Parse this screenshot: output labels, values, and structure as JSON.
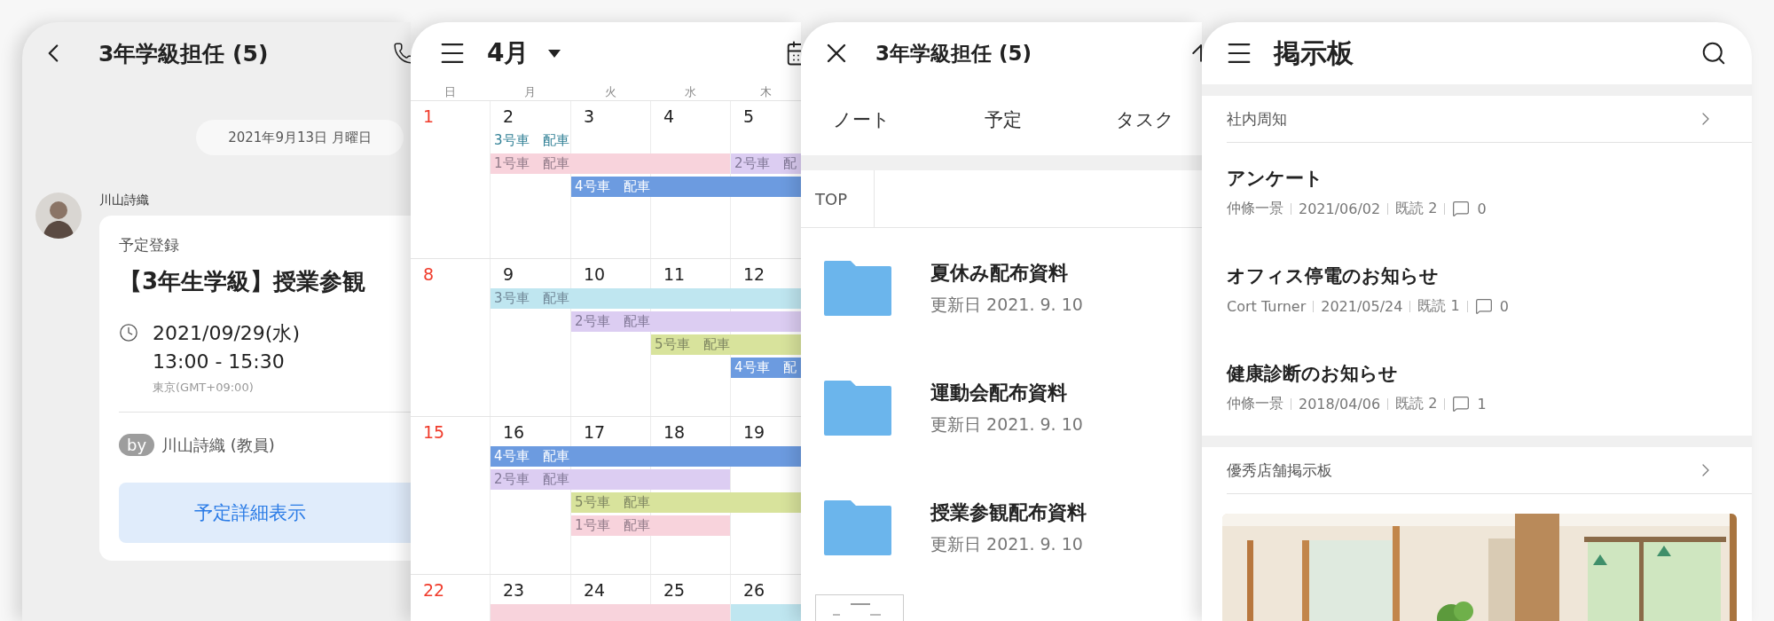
{
  "chat": {
    "title": "3年学級担任 (5)",
    "date_separator": "2021年9月13日 月曜日",
    "message": {
      "sender": "川山詩織",
      "card": {
        "label": "予定登録",
        "title": "【3年生学級】授業参観",
        "date": "2021/09/29(水)",
        "time": "13:00 - 15:30",
        "timezone": "東京(GMT+09:00)",
        "by_badge": "by",
        "author": "川山詩織 (教員)",
        "button": "予定詳細表示"
      }
    }
  },
  "calendar": {
    "month": "4月",
    "weekdays": [
      "日",
      "月",
      "火",
      "水",
      "木"
    ],
    "weeks": [
      {
        "days": [
          {
            "date": "1",
            "kind": "sunday"
          },
          {
            "date": "2",
            "kind": "weekday"
          },
          {
            "date": "3",
            "kind": "weekday"
          },
          {
            "date": "4",
            "kind": "weekday"
          },
          {
            "date": "5",
            "kind": "weekday"
          }
        ],
        "lanes": [
          [
            {
              "kind": "empty"
            },
            {
              "kind": "text",
              "label": "3号車　配車",
              "color": "#2f7f95"
            },
            {
              "kind": "empty"
            },
            {
              "kind": "empty"
            },
            {
              "kind": "empty"
            }
          ],
          [
            {
              "kind": "empty"
            },
            {
              "kind": "bar",
              "label": "1号車　配車",
              "color": "#f8d3dc"
            },
            {
              "kind": "continue"
            },
            {
              "kind": "continue"
            },
            {
              "kind": "bar",
              "label": "2号車　配",
              "color": "#dccdf2"
            }
          ],
          [
            {
              "kind": "empty"
            },
            {
              "kind": "empty"
            },
            {
              "kind": "bar",
              "label": "4号車　配車",
              "color": "#6c9be0"
            },
            {
              "kind": "continue"
            },
            {
              "kind": "continue"
            }
          ]
        ]
      },
      {
        "days": [
          {
            "date": "8",
            "kind": "sunday"
          },
          {
            "date": "9",
            "kind": "weekday"
          },
          {
            "date": "10",
            "kind": "weekday"
          },
          {
            "date": "11",
            "kind": "weekday"
          },
          {
            "date": "12",
            "kind": "weekday"
          }
        ],
        "lanes": [
          [
            {
              "kind": "empty"
            },
            {
              "kind": "bar",
              "label": "3号車　配車",
              "color": "#bfe6f0"
            },
            {
              "kind": "continue"
            },
            {
              "kind": "continue"
            },
            {
              "kind": "continue"
            }
          ],
          [
            {
              "kind": "empty"
            },
            {
              "kind": "empty"
            },
            {
              "kind": "bar",
              "label": "2号車　配車",
              "color": "#dccdf2"
            },
            {
              "kind": "continue"
            },
            {
              "kind": "continue"
            }
          ],
          [
            {
              "kind": "empty"
            },
            {
              "kind": "empty"
            },
            {
              "kind": "empty"
            },
            {
              "kind": "bar",
              "label": "5号車　配車",
              "color": "#d8e39c"
            },
            {
              "kind": "continue"
            }
          ],
          [
            {
              "kind": "empty"
            },
            {
              "kind": "empty"
            },
            {
              "kind": "empty"
            },
            {
              "kind": "empty"
            },
            {
              "kind": "bar",
              "label": "4号車　配",
              "color": "#6c9be0"
            }
          ]
        ]
      },
      {
        "days": [
          {
            "date": "15",
            "kind": "sunday"
          },
          {
            "date": "16",
            "kind": "weekday"
          },
          {
            "date": "17",
            "kind": "weekday"
          },
          {
            "date": "18",
            "kind": "weekday"
          },
          {
            "date": "19",
            "kind": "weekday"
          }
        ],
        "lanes": [
          [
            {
              "kind": "empty"
            },
            {
              "kind": "bar",
              "label": "4号車　配車",
              "color": "#6c9be0"
            },
            {
              "kind": "continue"
            },
            {
              "kind": "continue"
            },
            {
              "kind": "continue"
            }
          ],
          [
            {
              "kind": "empty"
            },
            {
              "kind": "bar",
              "label": "2号車　配車",
              "color": "#dccdf2"
            },
            {
              "kind": "continue"
            },
            {
              "kind": "continue"
            },
            {
              "kind": "empty"
            }
          ],
          [
            {
              "kind": "empty"
            },
            {
              "kind": "empty"
            },
            {
              "kind": "bar",
              "label": "5号車　配車",
              "color": "#d8e39c"
            },
            {
              "kind": "continue"
            },
            {
              "kind": "continue"
            }
          ],
          [
            {
              "kind": "empty"
            },
            {
              "kind": "empty"
            },
            {
              "kind": "bar",
              "label": "1号車　配車",
              "color": "#f8d3dc"
            },
            {
              "kind": "continue"
            },
            {
              "kind": "empty"
            }
          ]
        ]
      },
      {
        "days": [
          {
            "date": "22",
            "kind": "sunday"
          },
          {
            "date": "23",
            "kind": "weekday"
          },
          {
            "date": "24",
            "kind": "weekday"
          },
          {
            "date": "25",
            "kind": "weekday"
          },
          {
            "date": "26",
            "kind": "weekday"
          }
        ],
        "lanes": [
          [
            {
              "kind": "empty"
            },
            {
              "kind": "bar",
              "color": "#f8d3dc"
            },
            {
              "kind": "continue"
            },
            {
              "kind": "continue"
            },
            {
              "kind": "bar",
              "color": "#bfe6f0"
            }
          ]
        ]
      }
    ]
  },
  "notes": {
    "title": "3年学級担任 (5)",
    "tabs": [
      "ノート",
      "予定",
      "タスク"
    ],
    "breadcrumb": "TOP",
    "items": [
      {
        "kind": "folder",
        "title": "夏休み配布資料",
        "updated": "更新日 2021. 9. 10"
      },
      {
        "kind": "folder",
        "title": "運動会配布資料",
        "updated": "更新日 2021. 9. 10"
      },
      {
        "kind": "folder",
        "title": "授業参観配布資料",
        "updated": "更新日 2021. 9. 10"
      },
      {
        "kind": "document"
      }
    ]
  },
  "board": {
    "title": "掲示板",
    "sections": [
      {
        "kind": "posts",
        "title": "社内周知",
        "posts": [
          {
            "title": "アンケート",
            "author": "仲條一景",
            "date": "2021/06/02",
            "read": "既読 2",
            "comments": "0"
          },
          {
            "title": "オフィス停電のお知らせ",
            "author": "Cort Turner",
            "date": "2021/05/24",
            "read": "既読 1",
            "comments": "0"
          },
          {
            "title": "健康診断のお知らせ",
            "author": "仲條一景",
            "date": "2018/04/06",
            "read": "既読 2",
            "comments": "1"
          }
        ]
      },
      {
        "kind": "gallery",
        "title": "優秀店舗掲示板"
      }
    ]
  }
}
